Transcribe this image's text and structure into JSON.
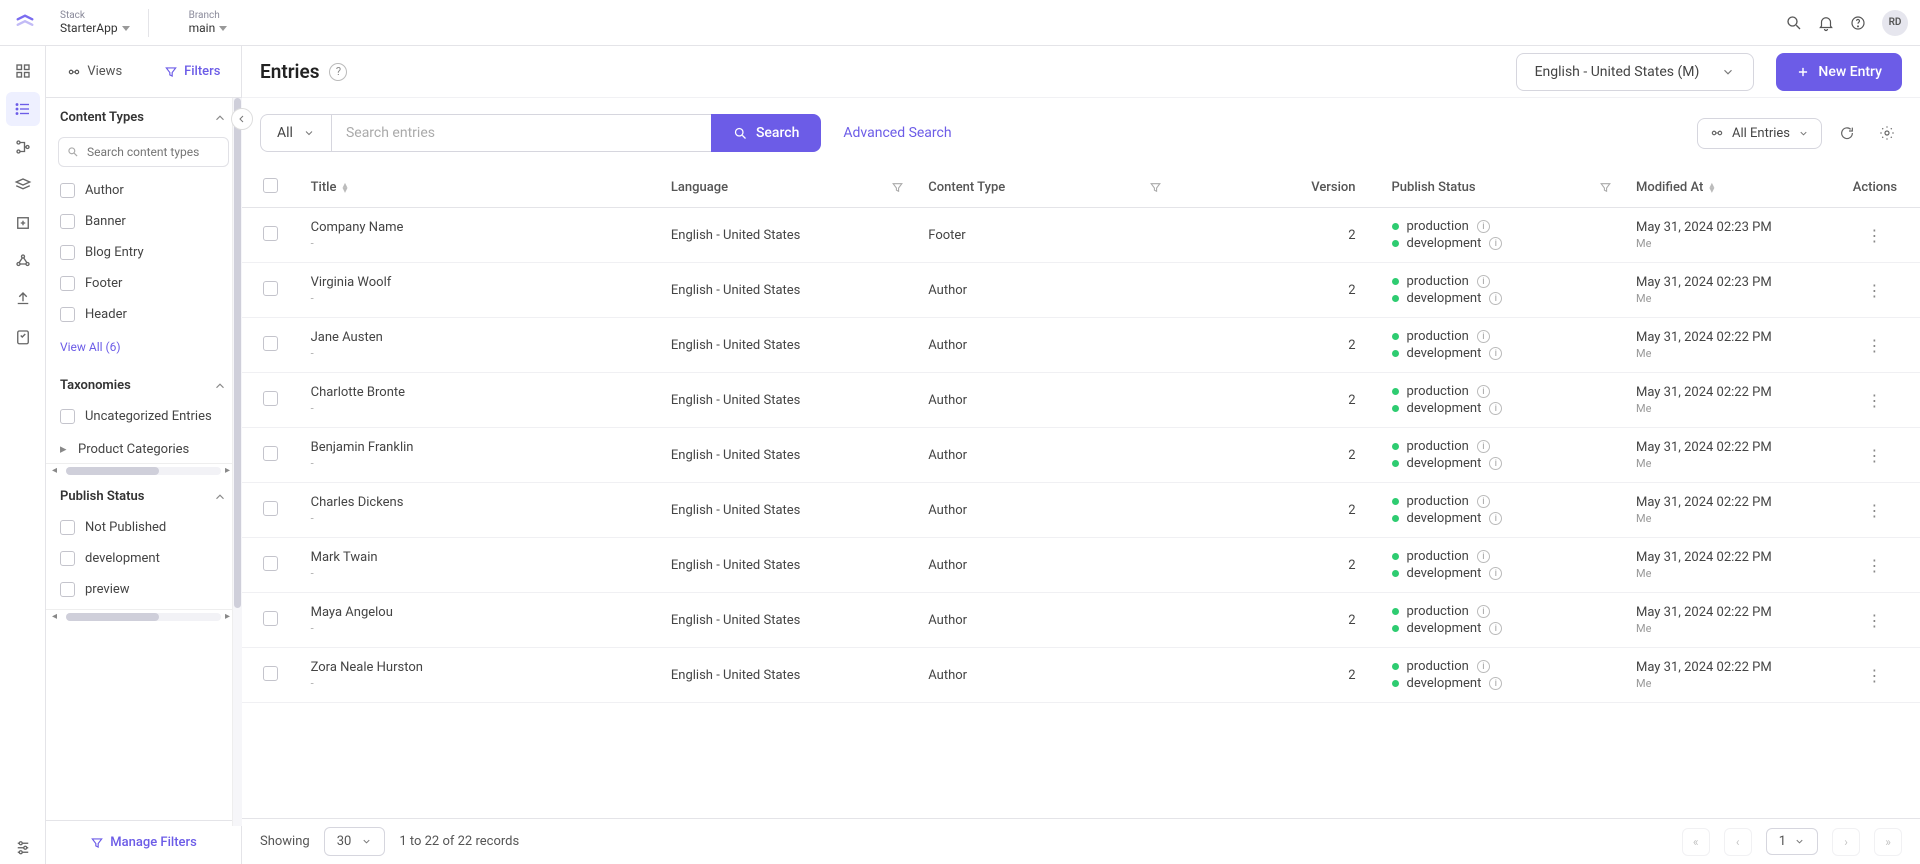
{
  "topbar": {
    "stack_label": "Stack",
    "stack_value": "StarterApp",
    "branch_label": "Branch",
    "branch_value": "main",
    "avatar": "RD"
  },
  "sidebar": {
    "tab_views": "Views",
    "tab_filters": "Filters",
    "content_types_label": "Content Types",
    "ct_search_placeholder": "Search content types",
    "ct_items": [
      "Author",
      "Banner",
      "Blog Entry",
      "Footer",
      "Header"
    ],
    "view_all": "View All (6)",
    "taxonomies_label": "Taxonomies",
    "tax_uncat": "Uncategorized Entries",
    "tax_product": "Product Categories",
    "publish_status_label": "Publish Status",
    "ps_items": [
      "Not Published",
      "development",
      "preview"
    ],
    "manage_filters": "Manage Filters"
  },
  "header": {
    "title": "Entries",
    "locale": "English - United States (M)",
    "new_entry": "New Entry"
  },
  "search": {
    "scope": "All",
    "placeholder": "Search entries",
    "button": "Search",
    "advanced": "Advanced Search",
    "all_entries_chip": "All Entries"
  },
  "columns": {
    "title": "Title",
    "language": "Language",
    "content_type": "Content Type",
    "version": "Version",
    "publish_status": "Publish Status",
    "modified_at": "Modified At",
    "actions": "Actions"
  },
  "common": {
    "lang": "English - United States",
    "env_prod": "production",
    "env_dev": "development",
    "me": "Me",
    "dash": "-"
  },
  "rows": [
    {
      "title": "Company Name",
      "ct": "Footer",
      "version": "2",
      "modified": "May 31, 2024 02:23 PM"
    },
    {
      "title": "Virginia Woolf",
      "ct": "Author",
      "version": "2",
      "modified": "May 31, 2024 02:23 PM"
    },
    {
      "title": "Jane Austen",
      "ct": "Author",
      "version": "2",
      "modified": "May 31, 2024 02:22 PM"
    },
    {
      "title": "Charlotte Bronte",
      "ct": "Author",
      "version": "2",
      "modified": "May 31, 2024 02:22 PM"
    },
    {
      "title": "Benjamin Franklin",
      "ct": "Author",
      "version": "2",
      "modified": "May 31, 2024 02:22 PM"
    },
    {
      "title": "Charles Dickens",
      "ct": "Author",
      "version": "2",
      "modified": "May 31, 2024 02:22 PM"
    },
    {
      "title": "Mark Twain",
      "ct": "Author",
      "version": "2",
      "modified": "May 31, 2024 02:22 PM"
    },
    {
      "title": "Maya Angelou",
      "ct": "Author",
      "version": "2",
      "modified": "May 31, 2024 02:22 PM"
    },
    {
      "title": "Zora Neale Hurston",
      "ct": "Author",
      "version": "2",
      "modified": "May 31, 2024 02:22 PM"
    }
  ],
  "footer": {
    "showing": "Showing",
    "page_size": "30",
    "range": "1 to 22 of 22 records",
    "page": "1"
  }
}
